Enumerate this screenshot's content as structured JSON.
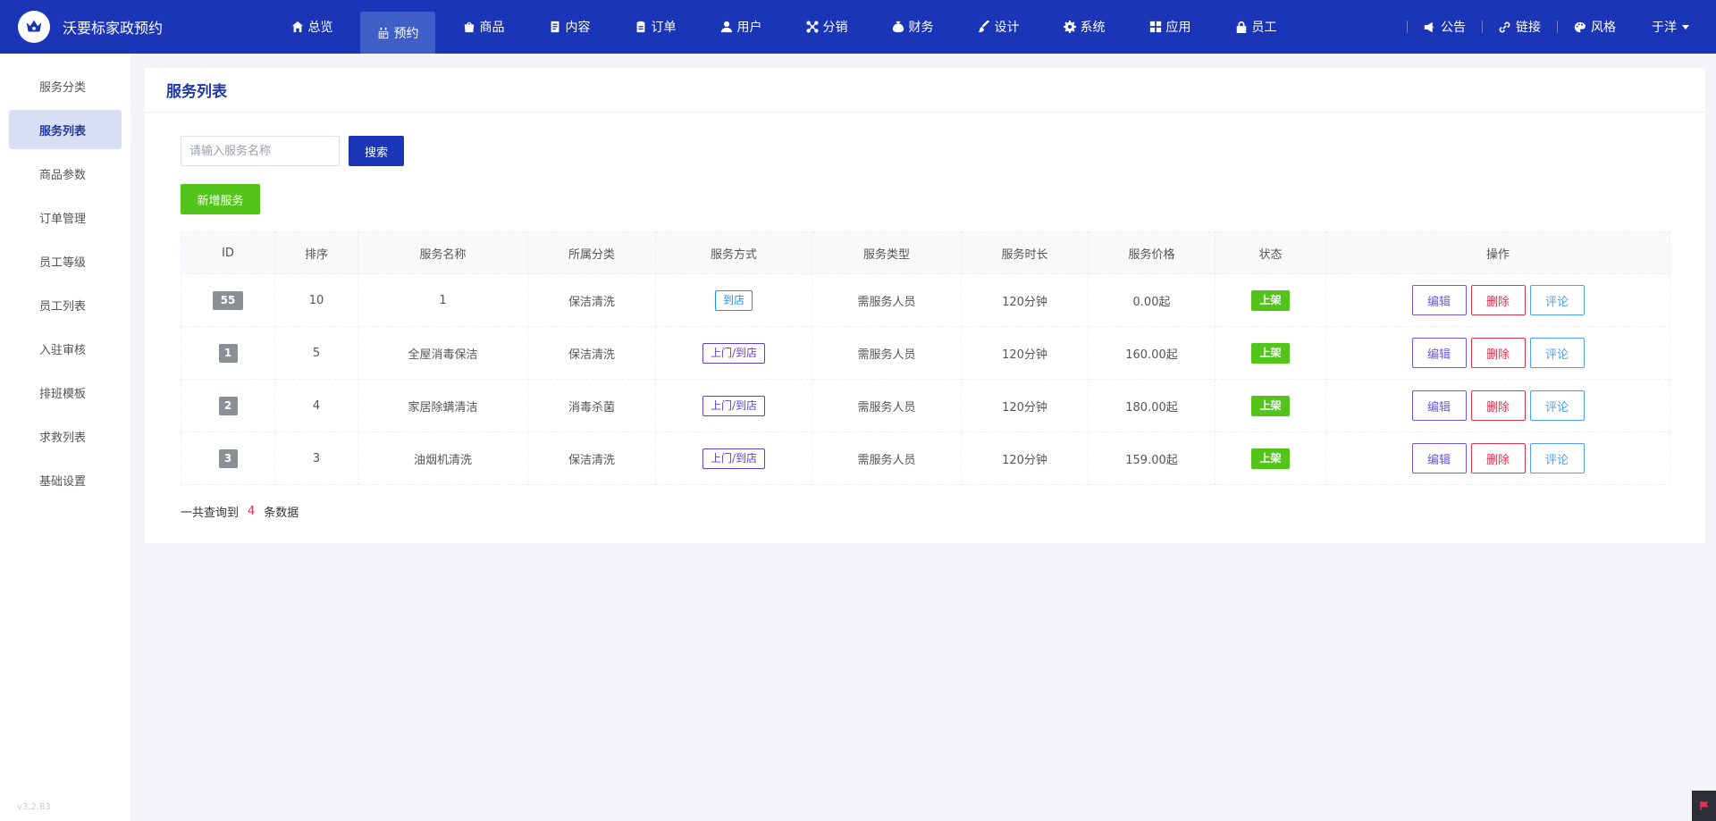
{
  "app": {
    "name": "沃要标家政预约"
  },
  "nav": {
    "items": [
      {
        "label": "总览",
        "icon": "home-icon"
      },
      {
        "label": "预约",
        "icon": "calendar-icon",
        "active": true
      },
      {
        "label": "商品",
        "icon": "bag-icon"
      },
      {
        "label": "内容",
        "icon": "document-icon"
      },
      {
        "label": "订单",
        "icon": "clipboard-icon"
      },
      {
        "label": "用户",
        "icon": "user-icon"
      },
      {
        "label": "分销",
        "icon": "share-icon"
      },
      {
        "label": "财务",
        "icon": "money-bag-icon"
      },
      {
        "label": "设计",
        "icon": "brush-icon"
      },
      {
        "label": "系统",
        "icon": "gear-icon"
      },
      {
        "label": "应用",
        "icon": "grid-icon"
      },
      {
        "label": "员工",
        "icon": "lock-icon"
      }
    ],
    "right": [
      {
        "label": "公告",
        "icon": "megaphone-icon"
      },
      {
        "label": "链接",
        "icon": "link-icon"
      },
      {
        "label": "风格",
        "icon": "palette-icon"
      }
    ],
    "user": "于洋"
  },
  "sidebar": {
    "items": [
      {
        "label": "服务分类"
      },
      {
        "label": "服务列表",
        "active": true
      },
      {
        "label": "商品参数"
      },
      {
        "label": "订单管理"
      },
      {
        "label": "员工等级"
      },
      {
        "label": "员工列表"
      },
      {
        "label": "入驻审核"
      },
      {
        "label": "排班模板"
      },
      {
        "label": "求救列表"
      },
      {
        "label": "基础设置"
      }
    ],
    "version": "v3.2.83"
  },
  "main": {
    "title": "服务列表",
    "search": {
      "placeholder": "请输入服务名称",
      "value": "",
      "button": "搜索"
    },
    "add_button": "新增服务",
    "table": {
      "headers": [
        "ID",
        "排序",
        "服务名称",
        "所属分类",
        "服务方式",
        "服务类型",
        "服务时长",
        "服务价格",
        "状态",
        "操作"
      ],
      "rows": [
        {
          "id": "55",
          "sort": "10",
          "name": "1",
          "category": "保洁清洗",
          "mode": "到店",
          "type": "需服务人员",
          "duration": "120分钟",
          "price": "0.00起",
          "status": "上架"
        },
        {
          "id": "1",
          "sort": "5",
          "name": "全屋消毒保洁",
          "category": "保洁清洗",
          "mode": "上门/到店",
          "type": "需服务人员",
          "duration": "120分钟",
          "price": "160.00起",
          "status": "上架"
        },
        {
          "id": "2",
          "sort": "4",
          "name": "家居除螨清洁",
          "category": "消毒杀菌",
          "mode": "上门/到店",
          "type": "需服务人员",
          "duration": "120分钟",
          "price": "180.00起",
          "status": "上架"
        },
        {
          "id": "3",
          "sort": "3",
          "name": "油烟机清洗",
          "category": "保洁清洗",
          "mode": "上门/到店",
          "type": "需服务人员",
          "duration": "120分钟",
          "price": "159.00起",
          "status": "上架"
        }
      ],
      "actions": {
        "edit": "编辑",
        "delete": "删除",
        "review": "评论"
      }
    },
    "total": {
      "prefix": "一共查询到",
      "count": "4",
      "suffix": "条数据"
    }
  },
  "colors": {
    "brand": "#1a36b6",
    "success": "#52c41a",
    "danger": "#e0334d",
    "accent": "#6e57e0",
    "info": "#4ba0f6"
  }
}
